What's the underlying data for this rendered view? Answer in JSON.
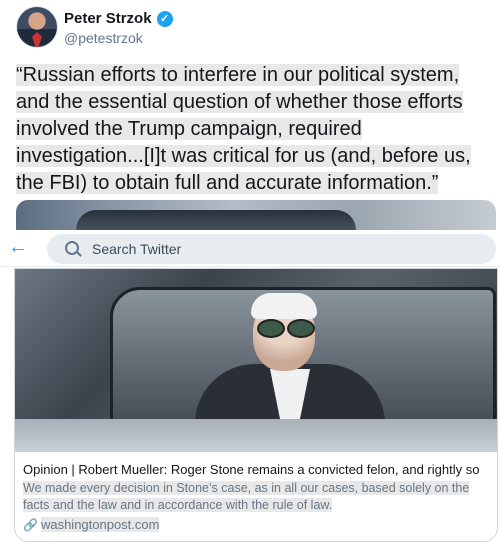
{
  "author": {
    "name": "Peter Strzok",
    "handle": "@petestrzok",
    "verified_glyph": "✓"
  },
  "tweet": {
    "text": "“Russian efforts to interfere in our political system, and the essential question of whether those efforts involved the Trump campaign, required investigation...[I]t was critical for us (and, before us, the FBI) to obtain full and accurate information.”"
  },
  "search": {
    "back_glyph": "←",
    "placeholder": "Search Twitter"
  },
  "card": {
    "title": "Opinion | Robert Mueller: Roger Stone remains a convicted felon, and rightly so",
    "description": "We made every decision in Stone’s case, as in all our cases, based solely on the facts and the law and in accordance with the rule of law.",
    "link_glyph": "🔗",
    "domain": "washingtonpost.com"
  },
  "icons": {
    "verified": "verified-badge-icon",
    "back": "back-arrow-icon",
    "search": "search-icon",
    "link": "link-icon"
  },
  "colors": {
    "accent": "#1da1f2",
    "secondary_text": "#657786",
    "highlight": "#e8e8e8"
  }
}
